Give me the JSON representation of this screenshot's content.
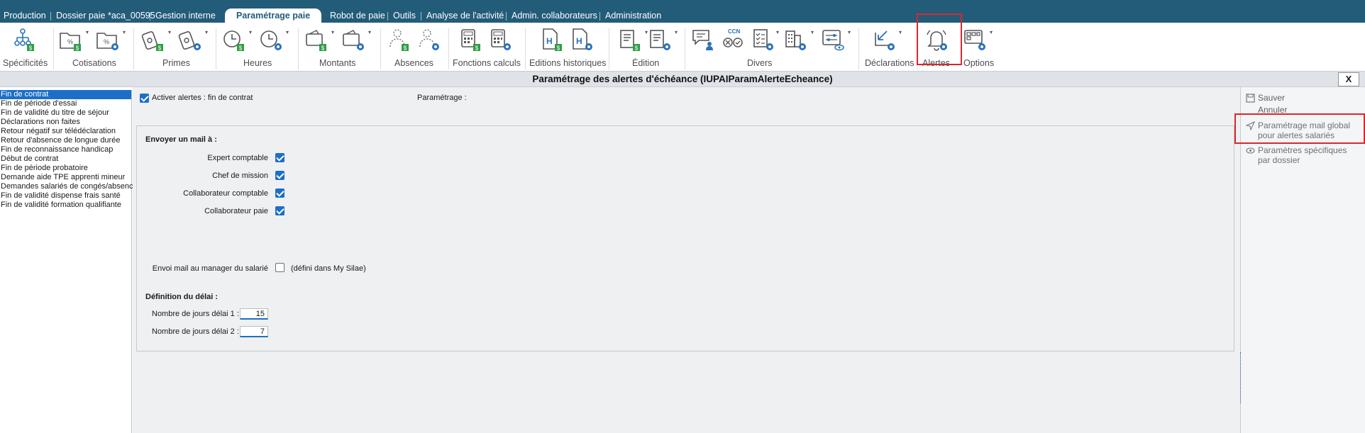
{
  "tabs": [
    {
      "label": "Production",
      "active": false
    },
    {
      "label": "Dossier paie *aca_00595",
      "active": false
    },
    {
      "label": "Gestion interne",
      "active": false
    },
    {
      "label": "Paramétrage paie",
      "active": true
    },
    {
      "label": "Robot de paie",
      "active": false
    },
    {
      "label": "Outils",
      "active": false
    },
    {
      "label": "Analyse de l'activité",
      "active": false
    },
    {
      "label": "Admin. collaborateurs",
      "active": false
    },
    {
      "label": "Administration",
      "active": false
    }
  ],
  "ribbon": {
    "groups": [
      {
        "label": "Spécificités"
      },
      {
        "label": "Cotisations"
      },
      {
        "label": "Primes"
      },
      {
        "label": "Heures"
      },
      {
        "label": "Montants"
      },
      {
        "label": "Absences"
      },
      {
        "label": "Fonctions calculs"
      },
      {
        "label": "Editions historiques"
      },
      {
        "label": "Édition"
      },
      {
        "label": "Divers"
      },
      {
        "label": "Déclarations"
      },
      {
        "label": "Alertes"
      },
      {
        "label": "Options"
      }
    ],
    "ccn_badge": "CCN",
    "accent_color": "#2a73b8",
    "badge_color": "#2e9e46"
  },
  "window": {
    "title": "Paramétrage des alertes d'échéance (IUPAIParamAlerteEcheance)",
    "close_label": "X"
  },
  "alert_list": [
    "Fin de contrat",
    "Fin de période d'essai",
    "Fin de validité du titre de séjour",
    "Déclarations non faites",
    "Retour négatif sur télédéclaration",
    "Retour d'absence de longue durée",
    "Fin de reconnaissance handicap",
    "Début de contrat",
    "Fin de période probatoire",
    "Demande aide TPE apprenti mineur",
    "Demandes salariés de congés/absence",
    "Fin de validité dispense frais santé",
    "Fin de validité formation qualifiante"
  ],
  "selected_alert": "Fin de contrat",
  "form": {
    "activate_label": "Activer alertes : fin de contrat",
    "activate_checked": true,
    "parametrage_label": "Paramétrage :",
    "send_mail_heading": "Envoyer un mail à :",
    "recipients": [
      {
        "label": "Expert comptable",
        "checked": true
      },
      {
        "label": "Chef de mission",
        "checked": true
      },
      {
        "label": "Collaborateur comptable",
        "checked": true
      },
      {
        "label": "Collaborateur paie",
        "checked": true
      }
    ],
    "manager_mail_label": "Envoi mail au manager du salarié",
    "manager_mail_checked": false,
    "manager_mail_note": "(défini dans My Silae)",
    "delay_heading": "Définition du délai :",
    "delay1_label": "Nombre de jours délai 1 :",
    "delay1_value": "15",
    "delay2_label": "Nombre de jours délai 2 :",
    "delay2_value": "7"
  },
  "actions": {
    "save": "Sauver",
    "cancel": "Annuler",
    "global_mail": "Paramétrage mail global pour alertes salariés",
    "specific_params": "Paramètres spécifiques par dossier"
  }
}
